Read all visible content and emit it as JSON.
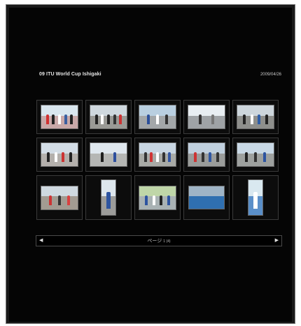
{
  "gallery": {
    "title": "09 ITU World Cup Ishigaki",
    "date": "2009/04/26"
  },
  "thumbnails": [
    {
      "label": "photo-1",
      "sky": "#d9e6ee",
      "ground": "#c9a9a9",
      "figs": [
        "#d03030",
        "#222",
        "#ffffff",
        "#3a5fa0",
        "#222"
      ]
    },
    {
      "label": "photo-2",
      "sky": "#cfd8de",
      "ground": "#9a9a96",
      "figs": [
        "#222",
        "#ffffff",
        "#222",
        "#333",
        "#cc3333"
      ]
    },
    {
      "label": "photo-3",
      "sky": "#b9cfe0",
      "ground": "#a3a7a9",
      "figs": [
        "#2b4f9a",
        "#ffffff",
        "#333"
      ]
    },
    {
      "label": "photo-4",
      "sky": "#e8eef2",
      "ground": "#9fa3a6",
      "figs": [
        "#333",
        "#777"
      ]
    },
    {
      "label": "photo-5",
      "sky": "#cdd6dc",
      "ground": "#8e8f8c",
      "figs": [
        "#222",
        "#ffffff",
        "#2e5da6",
        "#222"
      ]
    },
    {
      "label": "photo-6",
      "sky": "#d3dde6",
      "ground": "#b4b0ac",
      "figs": [
        "#222",
        "#ffffff",
        "#cc3333",
        "#222"
      ]
    },
    {
      "label": "photo-7",
      "sky": "#dfe7ee",
      "ground": "#b5b6b4",
      "figs": [
        "#1e1e1e",
        "#2d4f9d"
      ]
    },
    {
      "label": "photo-8",
      "sky": "#c8d6e2",
      "ground": "#a8aaa6",
      "figs": [
        "#333",
        "#d03434",
        "#ffffff",
        "#333",
        "#3558a3"
      ]
    },
    {
      "label": "photo-9",
      "sky": "#c0d0de",
      "ground": "#9a9c9a",
      "figs": [
        "#cc3333",
        "#333",
        "#2f57a3",
        "#333"
      ]
    },
    {
      "label": "photo-10",
      "sky": "#c9d9e6",
      "ground": "#9ea19f",
      "figs": [
        "#222",
        "#333",
        "#2d54a0"
      ]
    },
    {
      "label": "photo-11",
      "sky": "#cfd9e0",
      "ground": "#a29b92",
      "figs": [
        "#cc3333",
        "#333",
        "#d94040"
      ]
    },
    {
      "label": "photo-12",
      "sky": "#dde6ec",
      "ground": "#9c9c9a",
      "figs": [
        "#2d54a0"
      ],
      "portrait": true
    },
    {
      "label": "photo-13",
      "sky": "#bfd6a8",
      "ground": "#a9b2b4",
      "figs": [
        "#2d54a0",
        "#ffffff",
        "#222",
        "#2d54a0"
      ]
    },
    {
      "label": "photo-14",
      "sky": "#9fb4c6",
      "ground": "#2f6fb0",
      "figs": [],
      "wide": true
    },
    {
      "label": "photo-15",
      "sky": "#d9e8f0",
      "ground": "#5a8fc9",
      "figs": [
        "#ffffff"
      ],
      "portrait": true
    }
  ],
  "pager": {
    "prev_icon": "◀",
    "next_icon": "▶",
    "label": "ページ",
    "sub": "1 (4)"
  }
}
